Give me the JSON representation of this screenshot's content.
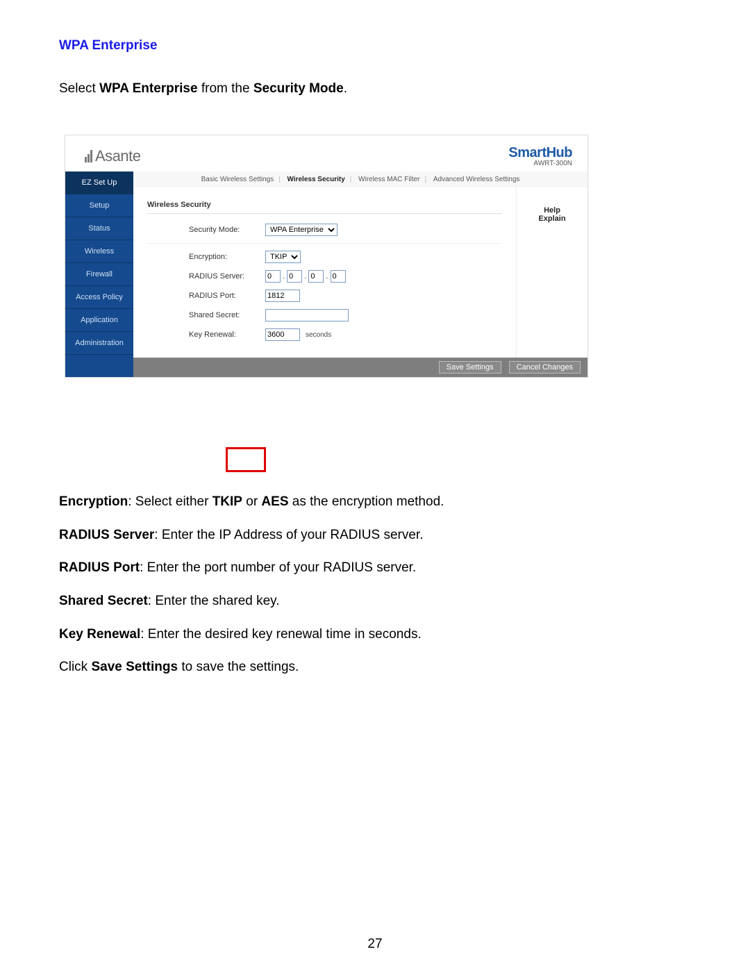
{
  "doc": {
    "section_title": "WPA Enterprise",
    "intro_pre": "Select ",
    "intro_bold1": "WPA Enterprise",
    "intro_mid": " from the ",
    "intro_bold2": "Security Mode",
    "intro_post": ".",
    "page_number": "27"
  },
  "router": {
    "logo_text": "Asante",
    "hub_primary": "SmartHub",
    "hub_sub": "AWRT-300N",
    "sidebar": [
      "EZ Set Up",
      "Setup",
      "Status",
      "Wireless",
      "Firewall",
      "Access Policy",
      "Application",
      "Administration"
    ],
    "sidebar_active_index": 0,
    "tabs": [
      "Basic Wireless Settings",
      "Wireless Security",
      "Wireless MAC Filter",
      "Advanced Wireless Settings"
    ],
    "tabs_active_index": 1,
    "panel_title": "Wireless Security",
    "labels": {
      "security_mode": "Security Mode:",
      "encryption": "Encryption:",
      "radius_server": "RADIUS Server:",
      "radius_port": "RADIUS Port:",
      "shared_secret": "Shared Secret:",
      "key_renewal": "Key Renewal:"
    },
    "values": {
      "security_mode": "WPA Enterprise",
      "encryption": "TKIP",
      "radius_server": [
        "0",
        "0",
        "0",
        "0"
      ],
      "radius_port": "1812",
      "shared_secret": "",
      "key_renewal": "3600",
      "key_renewal_unit": "seconds"
    },
    "help": {
      "line1": "Help",
      "line2": "Explain"
    },
    "buttons": {
      "save": "Save Settings",
      "cancel": "Cancel Changes"
    }
  },
  "descriptions": [
    {
      "bold": "Encryption",
      "rest_pre": ": Select either ",
      "bold2": "TKIP",
      "mid": " or ",
      "bold3": "AES",
      "rest_post": " as the encryption method."
    },
    {
      "bold": "RADIUS Server",
      "rest": ": Enter the IP Address of your RADIUS server."
    },
    {
      "bold": "RADIUS Port",
      "rest": ": Enter the port number of your RADIUS server."
    },
    {
      "bold": "Shared Secret",
      "rest": ": Enter the shared key."
    },
    {
      "bold": "Key Renewal",
      "rest": ": Enter the desired key renewal time in seconds."
    }
  ],
  "closing": {
    "pre": "Click ",
    "bold": "Save Settings",
    "post": " to save the settings."
  }
}
